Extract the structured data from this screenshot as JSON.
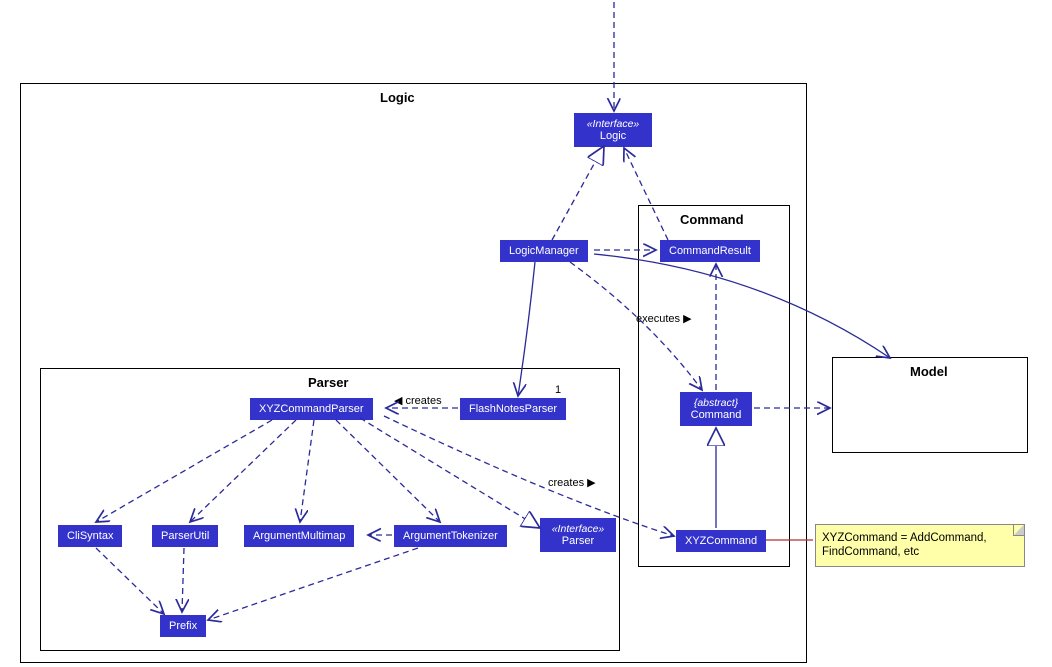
{
  "packages": {
    "logic": {
      "label": "Logic"
    },
    "parser": {
      "label": "Parser"
    },
    "command": {
      "label": "Command"
    },
    "model": {
      "label": "Model"
    }
  },
  "nodes": {
    "logic_iface": {
      "stereotype": "«Interface»",
      "name": "Logic"
    },
    "logic_manager": {
      "name": "LogicManager"
    },
    "command_result": {
      "name": "CommandResult"
    },
    "abstract_command": {
      "stereotype": "{abstract}",
      "name": "Command"
    },
    "xyz_command": {
      "name": "XYZCommand"
    },
    "xyz_command_parser": {
      "name": "XYZCommandParser"
    },
    "flashnotes_parser": {
      "name": "FlashNotesParser"
    },
    "parser_iface": {
      "stereotype": "«Interface»",
      "name": "Parser"
    },
    "cli_syntax": {
      "name": "CliSyntax"
    },
    "parser_util": {
      "name": "ParserUtil"
    },
    "argument_multimap": {
      "name": "ArgumentMultimap"
    },
    "argument_tokenizer": {
      "name": "ArgumentTokenizer"
    },
    "prefix": {
      "name": "Prefix"
    }
  },
  "edge_labels": {
    "creates_parser": "◀ creates",
    "creates_command": "creates ▶",
    "executes": "executes ▶"
  },
  "mult": {
    "one": "1"
  },
  "note": {
    "line1": "XYZCommand = AddCommand,",
    "line2": "FindCommand, etc"
  },
  "chart_data": {
    "type": "uml_class_diagram",
    "packages": [
      {
        "name": "Logic",
        "contains": [
          "«Interface» Logic",
          "LogicManager",
          "Parser (package)",
          "Command (package)"
        ]
      },
      {
        "name": "Parser",
        "contains": [
          "XYZCommandParser",
          "FlashNotesParser",
          "«Interface» Parser",
          "CliSyntax",
          "ParserUtil",
          "ArgumentMultimap",
          "ArgumentTokenizer",
          "Prefix"
        ]
      },
      {
        "name": "Command",
        "contains": [
          "CommandResult",
          "{abstract} Command",
          "XYZCommand"
        ]
      },
      {
        "name": "Model",
        "contains": []
      }
    ],
    "relationships": [
      {
        "from": "(external)",
        "to": "«Interface» Logic",
        "type": "dependency",
        "style": "dashed-open-arrow"
      },
      {
        "from": "LogicManager",
        "to": "«Interface» Logic",
        "type": "realization",
        "style": "dashed-hollow-triangle"
      },
      {
        "from": "LogicManager",
        "to": "CommandResult",
        "type": "dependency",
        "style": "dashed-open-arrow"
      },
      {
        "from": "LogicManager",
        "to": "{abstract} Command",
        "type": "dependency",
        "label": "executes ▶",
        "style": "dashed-open-arrow"
      },
      {
        "from": "LogicManager",
        "to": "FlashNotesParser",
        "type": "association",
        "multiplicity_to": "1",
        "style": "solid-open-arrow"
      },
      {
        "from": "LogicManager",
        "to": "Model (package)",
        "type": "association",
        "style": "solid-open-arrow"
      },
      {
        "from": "FlashNotesParser",
        "to": "XYZCommandParser",
        "type": "dependency",
        "label": "◀ creates",
        "style": "dashed-open-arrow"
      },
      {
        "from": "XYZCommandParser",
        "to": "«Interface» Parser",
        "type": "realization",
        "style": "dashed-hollow-triangle"
      },
      {
        "from": "XYZCommandParser",
        "to": "XYZCommand",
        "type": "dependency",
        "label": "creates ▶",
        "style": "dashed-open-arrow"
      },
      {
        "from": "XYZCommandParser",
        "to": "CliSyntax",
        "type": "dependency",
        "style": "dashed-open-arrow"
      },
      {
        "from": "XYZCommandParser",
        "to": "ParserUtil",
        "type": "dependency",
        "style": "dashed-open-arrow"
      },
      {
        "from": "XYZCommandParser",
        "to": "ArgumentMultimap",
        "type": "dependency",
        "style": "dashed-open-arrow"
      },
      {
        "from": "XYZCommandParser",
        "to": "ArgumentTokenizer",
        "type": "dependency",
        "style": "dashed-open-arrow"
      },
      {
        "from": "CliSyntax",
        "to": "Prefix",
        "type": "dependency",
        "style": "dashed-open-arrow"
      },
      {
        "from": "ParserUtil",
        "to": "Prefix",
        "type": "dependency",
        "style": "dashed-open-arrow"
      },
      {
        "from": "ArgumentTokenizer",
        "to": "ArgumentMultimap",
        "type": "dependency",
        "style": "dashed-open-arrow"
      },
      {
        "from": "ArgumentTokenizer",
        "to": "Prefix",
        "type": "dependency",
        "style": "dashed-open-arrow"
      },
      {
        "from": "XYZCommand",
        "to": "{abstract} Command",
        "type": "generalization",
        "style": "solid-hollow-triangle"
      },
      {
        "from": "{abstract} Command",
        "to": "CommandResult",
        "type": "dependency",
        "style": "dashed-open-arrow"
      },
      {
        "from": "{abstract} Command",
        "to": "Model (package)",
        "type": "dependency",
        "style": "dashed-open-arrow"
      },
      {
        "from": "(note)",
        "to": "XYZCommand",
        "type": "note-anchor",
        "style": "solid-line"
      }
    ],
    "notes": [
      {
        "text": "XYZCommand = AddCommand, FindCommand, etc",
        "attached_to": "XYZCommand"
      }
    ]
  }
}
